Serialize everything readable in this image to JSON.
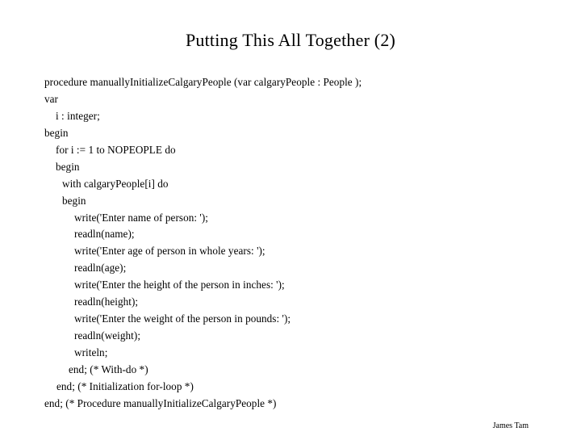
{
  "slide": {
    "title": "Putting This All Together (2)",
    "code_lines": [
      {
        "text": "procedure manuallyInitializeCalgaryPeople (var calgaryPeople : People );",
        "indent": "ind-0"
      },
      {
        "text": "var",
        "indent": "ind-0"
      },
      {
        "text": "i : integer;",
        "indent": "ind-1"
      },
      {
        "text": "begin",
        "indent": "ind-0"
      },
      {
        "text": "for i := 1 to NOPEOPLE do",
        "indent": "ind-1"
      },
      {
        "text": "begin",
        "indent": "ind-1"
      },
      {
        "text": "with calgaryPeople[i] do",
        "indent": "ind-2"
      },
      {
        "text": "begin",
        "indent": "ind-2"
      },
      {
        "text": "write('Enter name of person: ');",
        "indent": "ind-3"
      },
      {
        "text": "readln(name);",
        "indent": "ind-3"
      },
      {
        "text": "write('Enter age of person in whole years: ');",
        "indent": "ind-3"
      },
      {
        "text": "readln(age);",
        "indent": "ind-3"
      },
      {
        "text": "write('Enter the height of the person in inches: ');",
        "indent": "ind-3"
      },
      {
        "text": "readln(height);",
        "indent": "ind-3"
      },
      {
        "text": "write('Enter the weight of the person in pounds: ');",
        "indent": "ind-3"
      },
      {
        "text": "readln(weight);",
        "indent": "ind-3"
      },
      {
        "text": "writeln;",
        "indent": "ind-3"
      },
      {
        "text": "end; (* With-do *)",
        "indent": "ind-end-with"
      },
      {
        "text": "end; (* Initialization for-loop *)",
        "indent": "ind-end-for"
      },
      {
        "text": "end; (* Procedure manuallyInitializeCalgaryPeople *)",
        "indent": "ind-0"
      }
    ],
    "footer_author": "James Tam"
  }
}
